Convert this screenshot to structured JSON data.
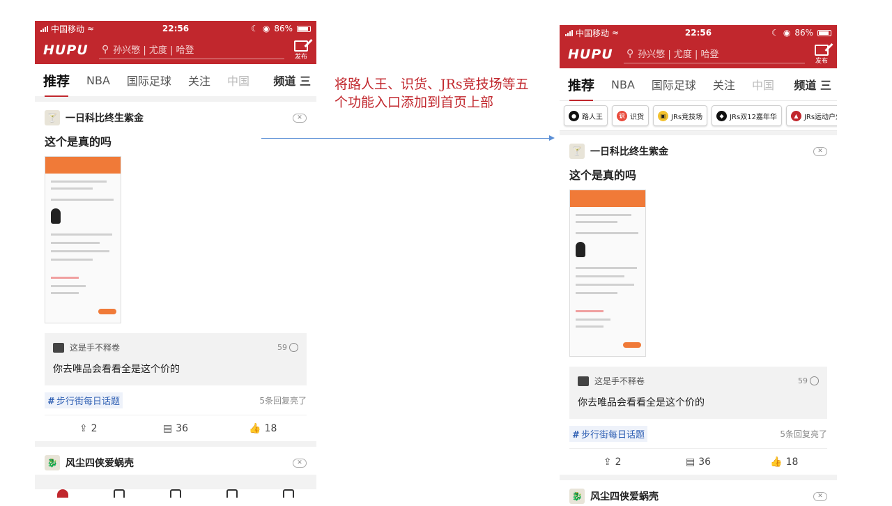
{
  "status_bar": {
    "carrier": "中国移动",
    "time": "22:56",
    "battery": "86%"
  },
  "header": {
    "logo": "HUPU",
    "search_placeholder": "孙兴慜 | 尤度 | 哈登",
    "publish_label": "发布"
  },
  "tabs": {
    "items": [
      "推荐",
      "NBA",
      "国际足球",
      "关注",
      "中国"
    ],
    "active": "推荐",
    "channel_label": "频道 三"
  },
  "shortcuts": [
    {
      "label": "路人王",
      "icon": "lurenwang-icon",
      "color": "#111111"
    },
    {
      "label": "识货",
      "icon": "shihuo-icon",
      "color": "#e94b3c"
    },
    {
      "label": "JRs竞技场",
      "icon": "arena-icon",
      "color": "#f2c12e"
    },
    {
      "label": "JRs双12嘉年华",
      "icon": "carnival-icon",
      "color": "#111111"
    },
    {
      "label": "JRs运动户外",
      "icon": "outdoor-icon",
      "color": "#c1272d"
    }
  ],
  "post": {
    "author": "一日科比终生紫金",
    "title": "这个是真的吗",
    "comment": {
      "user": "这是手不释卷",
      "likes": "59",
      "text": "你去唯品会看看全是这个价的"
    },
    "topic": "步行街每日话题",
    "replies_hint": "5条回复亮了",
    "share_count": "2",
    "comment_count": "36",
    "like_count": "18"
  },
  "post2": {
    "author": "风尘四侠爱蜗壳"
  },
  "annotation": {
    "text": "将路人王、识货、JRs竞技场等五个功能入口添加到首页上部"
  },
  "colors": {
    "brand_red": "#c1272d",
    "topic_blue": "#2e5fb3",
    "arrow_blue": "#5b8fd6"
  }
}
